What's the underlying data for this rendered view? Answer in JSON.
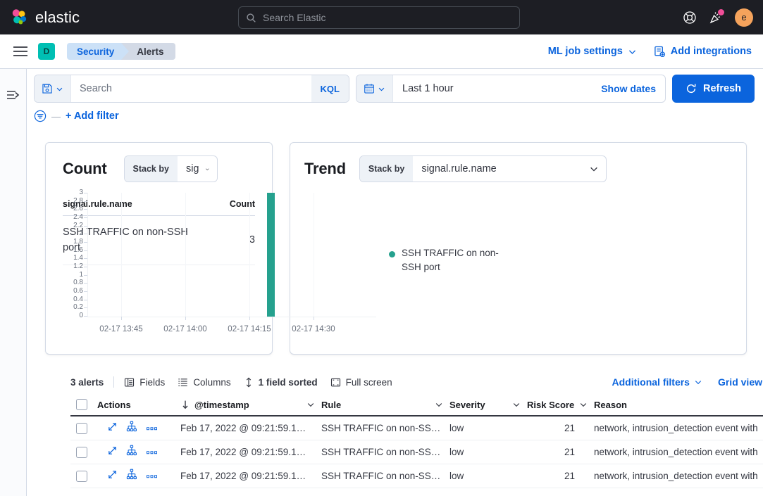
{
  "header": {
    "brand": "elastic",
    "search_placeholder": "Search Elastic",
    "search_icon": "search-icon",
    "help_icon": "help-lifebuoy-icon",
    "news_icon": "announcement-cheer-icon",
    "avatar_initial": "e",
    "avatar_color": "#f5a35c"
  },
  "breadcrumb": {
    "menu_icon": "hamburger-menu-icon",
    "space_initial": "D",
    "space_color": "#00bfb3",
    "items": [
      {
        "label": "Security"
      },
      {
        "label": "Alerts"
      }
    ],
    "actions": [
      {
        "label": "ML job settings",
        "icon": "chevron-down-icon"
      },
      {
        "label": "Add integrations",
        "icon": "integrations-icon"
      }
    ]
  },
  "rail": {
    "toggle_icon": "expand-sidebar-icon"
  },
  "query_bar": {
    "save_icon": "save-query-icon",
    "search_placeholder": "Search",
    "query_language": "KQL",
    "date_icon": "calendar-icon",
    "date_value": "Last 1 hour",
    "show_dates_label": "Show dates",
    "refresh_label": "Refresh",
    "refresh_icon": "refresh-icon",
    "filter_icon": "filter-icon",
    "filter_dash": "—",
    "add_filter_label": "+ Add filter"
  },
  "count_panel": {
    "title": "Count",
    "stack_by_label": "Stack by",
    "stack_by_value": "signal",
    "columns": [
      "signal.rule.name",
      "Count"
    ],
    "rows": [
      {
        "name": "SSH TRAFFIC on non-SSH port",
        "count": "3"
      }
    ]
  },
  "trend_panel": {
    "title": "Trend",
    "stack_by_label": "Stack by",
    "stack_by_value": "signal.rule.name"
  },
  "chart_data": {
    "type": "bar",
    "title": "Trend",
    "xlabel": "",
    "ylabel": "",
    "ylim": [
      0,
      3
    ],
    "yticks": [
      "3",
      "2.8",
      "2.6",
      "2.4",
      "2.2",
      "2",
      "1.8",
      "1.6",
      "1.4",
      "1.2",
      "1",
      "0.8",
      "0.6",
      "0.4",
      "0.2",
      "0"
    ],
    "xticks": [
      "02-17 13:45",
      "02-17 14:00",
      "02-17 14:15",
      "02-17 14:30"
    ],
    "grid": true,
    "legend_position": "right",
    "series": [
      {
        "name": "SSH TRAFFIC on non-SSH port",
        "color": "#25a18e",
        "x": [
          "02-17 14:22"
        ],
        "values": [
          3
        ]
      }
    ]
  },
  "grid_toolbar": {
    "alerts_count": "3 alerts",
    "buttons": [
      {
        "label": "Fields",
        "icon": "fields-icon"
      },
      {
        "label": "Columns",
        "icon": "columns-icon"
      },
      {
        "label": "1 field sorted",
        "icon": "sort-icon",
        "bold": true
      },
      {
        "label": "Full screen",
        "icon": "fullscreen-icon"
      }
    ],
    "right_links": [
      {
        "label": "Additional filters",
        "icon": "chevron-down-icon"
      },
      {
        "label": "Grid view",
        "icon": "chevron-down-icon"
      }
    ]
  },
  "data_grid": {
    "columns": [
      {
        "key": "actions",
        "label": "Actions",
        "sortable": false
      },
      {
        "key": "timestamp",
        "label": "@timestamp",
        "sorted": "desc"
      },
      {
        "key": "rule",
        "label": "Rule"
      },
      {
        "key": "severity",
        "label": "Severity"
      },
      {
        "key": "risk",
        "label": "Risk Score"
      },
      {
        "key": "reason",
        "label": "Reason"
      }
    ],
    "row_action_icons": [
      "expand-alert-icon",
      "analyzer-graph-icon",
      "more-actions-icon"
    ],
    "rows": [
      {
        "timestamp": "Feb 17, 2022 @ 09:21:59.1…",
        "rule": "SSH TRAFFIC on non-SS…",
        "severity": "low",
        "risk": "21",
        "reason": "network, intrusion_detection event with"
      },
      {
        "timestamp": "Feb 17, 2022 @ 09:21:59.1…",
        "rule": "SSH TRAFFIC on non-SS…",
        "severity": "low",
        "risk": "21",
        "reason": "network, intrusion_detection event with"
      },
      {
        "timestamp": "Feb 17, 2022 @ 09:21:59.1…",
        "rule": "SSH TRAFFIC on non-SS…",
        "severity": "low",
        "risk": "21",
        "reason": "network, intrusion_detection event with"
      }
    ]
  }
}
